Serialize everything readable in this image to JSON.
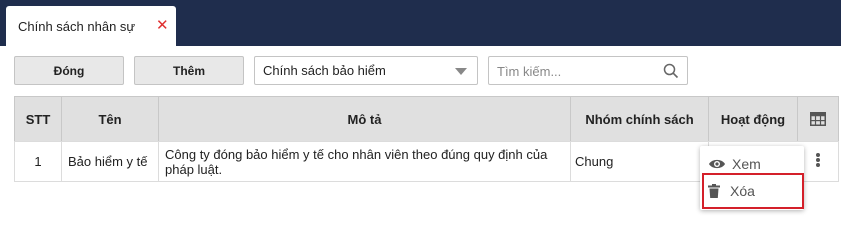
{
  "tab": {
    "label": "Chính sách nhân sự",
    "close_glyph": "✕"
  },
  "toolbar": {
    "close_label": "Đóng",
    "add_label": "Thêm",
    "policy_select_value": "Chính sách bảo hiểm",
    "search_placeholder": "Tìm kiếm..."
  },
  "table": {
    "headers": {
      "stt": "STT",
      "name": "Tên",
      "description": "Mô tả",
      "group": "Nhóm chính sách",
      "action": "Hoạt động"
    },
    "rows": [
      {
        "stt": "1",
        "name": "Bảo hiểm y tế",
        "description": "Công ty đóng bảo hiểm y tế cho nhân viên theo đúng quy định của pháp luật.",
        "group": "Chung"
      }
    ]
  },
  "row_menu": {
    "view_label": "Xem",
    "delete_label": "Xóa"
  },
  "colors": {
    "topbar": "#1f2d4d",
    "close_red": "#e03030",
    "highlight_red": "#d4202a",
    "header_bg": "#e0e0e0"
  }
}
